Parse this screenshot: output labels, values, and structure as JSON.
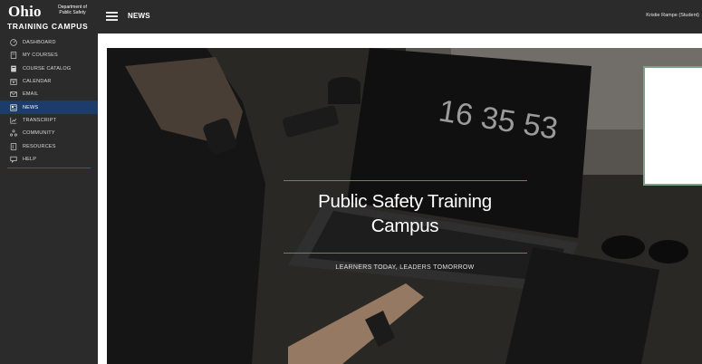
{
  "logo": {
    "name": "Ohio",
    "department_line1": "Department of",
    "department_line2": "Public Safety",
    "campus": "TRAINING CAMPUS"
  },
  "sidebar": {
    "items": [
      {
        "label": "DASHBOARD",
        "icon": "dashboard-gauge-icon",
        "active": false
      },
      {
        "label": "MY COURSES",
        "icon": "book-icon",
        "active": false
      },
      {
        "label": "COURSE CATALOG",
        "icon": "catalog-icon",
        "active": false
      },
      {
        "label": "CALENDAR",
        "icon": "calendar-icon",
        "active": false
      },
      {
        "label": "EMAIL",
        "icon": "envelope-icon",
        "active": false
      },
      {
        "label": "NEWS",
        "icon": "newspaper-icon",
        "active": true
      },
      {
        "label": "TRANSCRIPT",
        "icon": "chart-icon",
        "active": false
      },
      {
        "label": "COMMUNITY",
        "icon": "community-icon",
        "active": false
      },
      {
        "label": "RESOURCES",
        "icon": "resources-icon",
        "active": false
      },
      {
        "label": "HELP",
        "icon": "help-chat-icon",
        "active": false
      }
    ]
  },
  "header": {
    "title": "NEWS",
    "user": "Kristie Rampe (Student)"
  },
  "hero": {
    "clock": "16 35 53",
    "title_line1": "Public Safety Training",
    "title_line2": "Campus",
    "tagline": "LEARNERS TODAY, LEADERS TOMORROW"
  },
  "colors": {
    "sidebar_bg": "#2b2b2b",
    "active_item": "#1c3c6a",
    "accent_line": "#e04b4b",
    "card_border": "#7aa38a"
  }
}
